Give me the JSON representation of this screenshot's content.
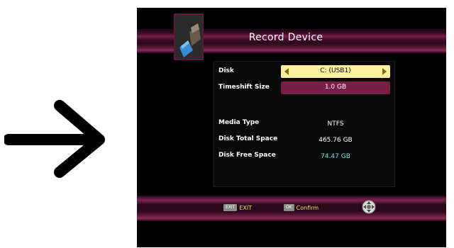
{
  "header": {
    "title": "Record Device",
    "device_icon": "usb-drive-icon"
  },
  "form": {
    "disk": {
      "label": "Disk",
      "value": "C: (USB1)"
    },
    "timeshift": {
      "label": "Timeshift Size",
      "value": "1.0 GB"
    },
    "media_type": {
      "label": "Media Type",
      "value": "NTFS"
    },
    "total_space": {
      "label": "Disk Total Space",
      "value": "465.76 GB"
    },
    "free_space": {
      "label": "Disk Free Space",
      "value": "74.47 GB"
    }
  },
  "footer": {
    "exit": {
      "key": "EXIT",
      "label": "EXIT"
    },
    "confirm": {
      "key": "OK",
      "label": "Confirm"
    },
    "nav_icon": "dpad-navigation-icon"
  },
  "colors": {
    "accent": "#7a1f44",
    "highlight": "#fff0a0",
    "hint": "#f0e060",
    "value_green": "#7fe0d8"
  },
  "decoration": {
    "left_arrow_icon": "right-arrow-icon"
  }
}
